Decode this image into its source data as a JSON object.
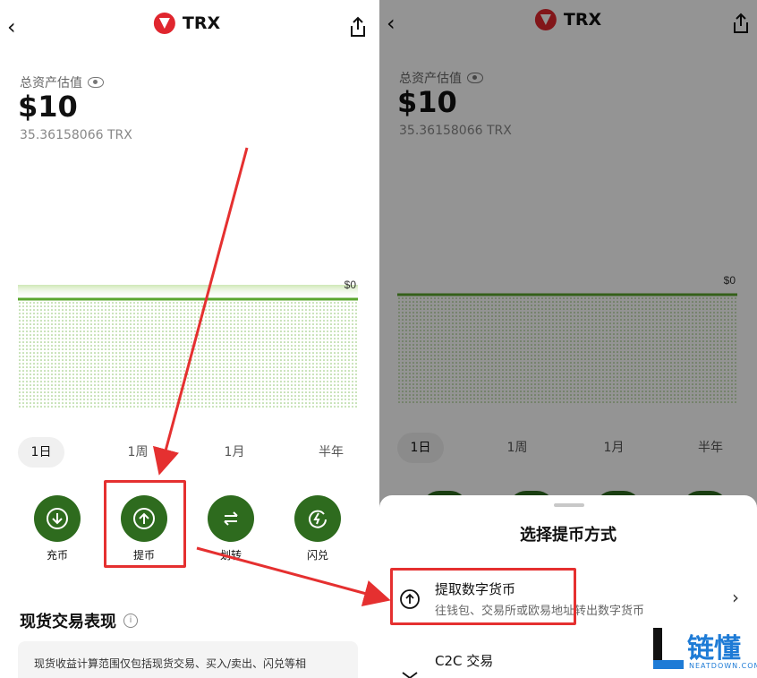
{
  "left": {
    "header": {
      "coin_name": "TRX",
      "back_icon": "chevron-left-icon",
      "share_icon": "share-icon"
    },
    "asset": {
      "label": "总资产估值",
      "value": "$10",
      "sub_value": "35.36158066 TRX"
    },
    "chart": {
      "price_label": "$0",
      "line_color": "#6db33f"
    },
    "periods": [
      "1日",
      "1周",
      "1月",
      "半年"
    ],
    "active_period": "1日",
    "actions": [
      {
        "label": "充币",
        "icon": "deposit-icon"
      },
      {
        "label": "提币",
        "icon": "withdraw-icon"
      },
      {
        "label": "划转",
        "icon": "transfer-icon"
      },
      {
        "label": "闪兑",
        "icon": "flash-swap-icon"
      }
    ],
    "section": {
      "title": "现货交易表现",
      "note": "现货收益计算范围仅包括现货交易、买入/卖出、闪兑等相"
    }
  },
  "right": {
    "header": {
      "coin_name": "TRX"
    },
    "asset": {
      "label": "总资产估值",
      "value": "$10",
      "sub_value": "35.36158066 TRX"
    },
    "chart": {
      "price_label": "$0"
    },
    "periods": [
      "1日",
      "1周",
      "1月",
      "半年"
    ],
    "sheet": {
      "title": "选择提币方式",
      "options": [
        {
          "title": "提取数字货币",
          "subtitle": "往钱包、交易所或欧易地址转出数字货币"
        },
        {
          "title": "C2C 交易",
          "subtitle": ""
        }
      ]
    }
  },
  "watermark": {
    "text": "链懂",
    "sub": "NEATDOWN.COM"
  },
  "colors": {
    "accent_green": "#2e6b1e",
    "highlight_red": "#e53030",
    "brand_red": "#e0262e"
  }
}
